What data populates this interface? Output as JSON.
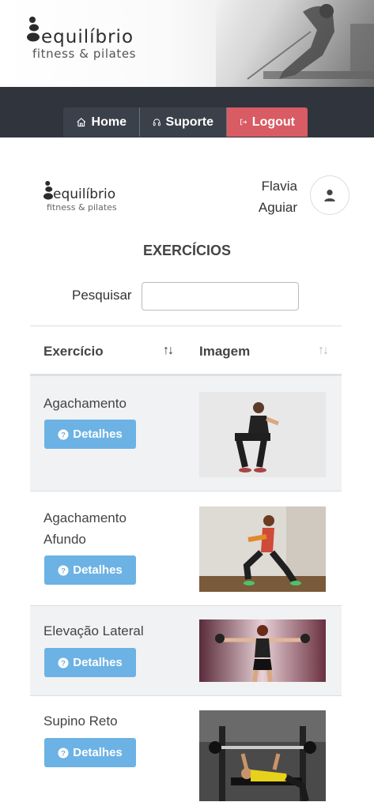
{
  "brand": {
    "name": "equilíbrio",
    "tagline": "fitness & pilates"
  },
  "nav": {
    "home": "Home",
    "suporte": "Suporte",
    "logout": "Logout"
  },
  "user": {
    "first_name": "Flavia",
    "last_name": "Aguiar"
  },
  "page": {
    "title": "EXERCÍCIOS"
  },
  "search": {
    "label": "Pesquisar",
    "value": "",
    "placeholder": ""
  },
  "table": {
    "columns": [
      "Exercício",
      "Imagem"
    ],
    "details_label": "Detalhes",
    "rows": [
      {
        "name": "Agachamento",
        "image": "woman-squat-photo"
      },
      {
        "name": "Agachamento Afundo",
        "image": "woman-lunge-photo"
      },
      {
        "name": "Elevação Lateral",
        "image": "woman-lateral-raise-photo"
      },
      {
        "name": "Supino Reto",
        "image": "man-bench-press-photo"
      }
    ]
  },
  "colors": {
    "navbar": "#2f343d",
    "logout": "#d95b63",
    "details_button": "#6cb2e4",
    "row_stripe": "#f1f2f4"
  }
}
